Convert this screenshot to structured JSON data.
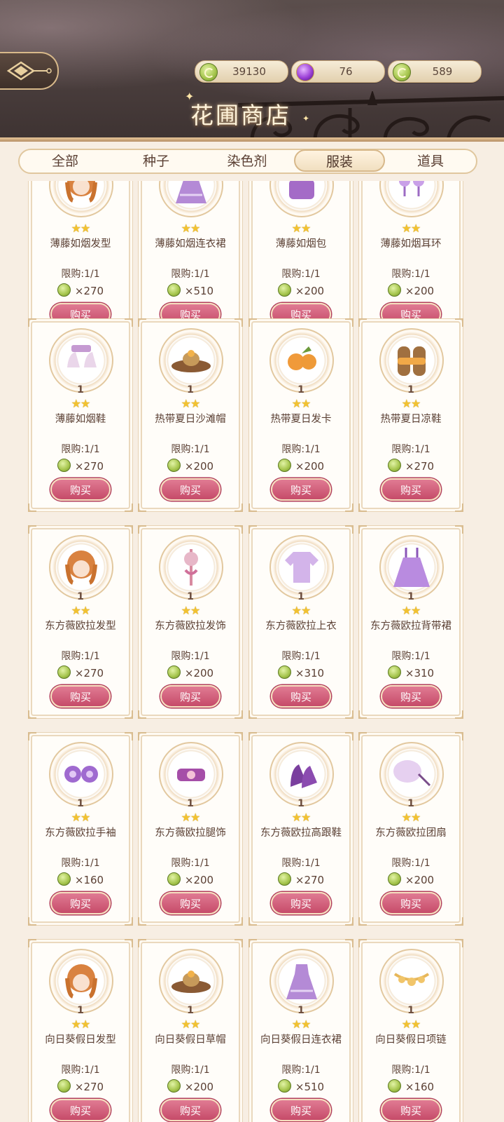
{
  "header": {
    "title": "花圃商店",
    "currencies": [
      {
        "icon": "green-coin-icon",
        "value": "39130"
      },
      {
        "icon": "purple-gem-icon",
        "value": "76"
      },
      {
        "icon": "green-coin-icon",
        "value": "589"
      }
    ]
  },
  "tabs": [
    {
      "label": "全部",
      "active": false
    },
    {
      "label": "种子",
      "active": false
    },
    {
      "label": "染色剂",
      "active": false
    },
    {
      "label": "服装",
      "active": true
    },
    {
      "label": "道具",
      "active": false
    }
  ],
  "buy_label": "购买",
  "colors": {
    "accent": "#c64b69",
    "star": "#f2c230",
    "background": "#f7eee3"
  },
  "rows": [
    [
      {
        "name": "薄藤如烟发型",
        "qty": "",
        "stars": "★★",
        "limit": "限购:1/1",
        "price": "×270",
        "icon": "hairstyle-icon"
      },
      {
        "name": "薄藤如烟连衣裙",
        "qty": "",
        "stars": "★★",
        "limit": "限购:1/1",
        "price": "×510",
        "icon": "dress-icon"
      },
      {
        "name": "薄藤如烟包",
        "qty": "",
        "stars": "★★",
        "limit": "限购:1/1",
        "price": "×200",
        "icon": "bag-icon"
      },
      {
        "name": "薄藤如烟耳环",
        "qty": "",
        "stars": "★★",
        "limit": "限购:1/1",
        "price": "×200",
        "icon": "earring-icon"
      }
    ],
    [
      {
        "name": "薄藤如烟鞋",
        "qty": "1",
        "stars": "★★",
        "limit": "限购:1/1",
        "price": "×270",
        "icon": "shoes-icon"
      },
      {
        "name": "热带夏日沙滩帽",
        "qty": "1",
        "stars": "★★",
        "limit": "限购:1/1",
        "price": "×200",
        "icon": "straw-hat-icon"
      },
      {
        "name": "热带夏日发卡",
        "qty": "1",
        "stars": "★★",
        "limit": "限购:1/1",
        "price": "×200",
        "icon": "hairclip-icon"
      },
      {
        "name": "热带夏日凉鞋",
        "qty": "1",
        "stars": "★★",
        "limit": "限购:1/1",
        "price": "×270",
        "icon": "sandals-icon"
      }
    ],
    [
      {
        "name": "东方薇欧拉发型",
        "qty": "1",
        "stars": "★★",
        "limit": "限购:1/1",
        "price": "×270",
        "icon": "hairstyle-icon"
      },
      {
        "name": "东方薇欧拉发饰",
        "qty": "1",
        "stars": "★★",
        "limit": "限购:1/1",
        "price": "×200",
        "icon": "hair-ornament-icon"
      },
      {
        "name": "东方薇欧拉上衣",
        "qty": "1",
        "stars": "★★",
        "limit": "限购:1/1",
        "price": "×310",
        "icon": "top-icon"
      },
      {
        "name": "东方薇欧拉背带裙",
        "qty": "1",
        "stars": "★★",
        "limit": "限购:1/1",
        "price": "×310",
        "icon": "pinafore-dress-icon"
      }
    ],
    [
      {
        "name": "东方薇欧拉手袖",
        "qty": "1",
        "stars": "★★",
        "limit": "限购:1/1",
        "price": "×160",
        "icon": "sleeves-icon"
      },
      {
        "name": "东方薇欧拉腿饰",
        "qty": "1",
        "stars": "★★",
        "limit": "限购:1/1",
        "price": "×200",
        "icon": "leg-ornament-icon"
      },
      {
        "name": "东方薇欧拉高跟鞋",
        "qty": "1",
        "stars": "★★",
        "limit": "限购:1/1",
        "price": "×270",
        "icon": "heels-icon"
      },
      {
        "name": "东方薇欧拉团扇",
        "qty": "1",
        "stars": "★★",
        "limit": "限购:1/1",
        "price": "×200",
        "icon": "fan-icon"
      }
    ],
    [
      {
        "name": "向日葵假日发型",
        "qty": "1",
        "stars": "★★",
        "limit": "限购:1/1",
        "price": "×270",
        "icon": "hairstyle-icon"
      },
      {
        "name": "向日葵假日草帽",
        "qty": "1",
        "stars": "★★",
        "limit": "限购:1/1",
        "price": "×200",
        "icon": "straw-hat-icon"
      },
      {
        "name": "向日葵假日连衣裙",
        "qty": "1",
        "stars": "★★",
        "limit": "限购:1/1",
        "price": "×510",
        "icon": "dress-icon"
      },
      {
        "name": "向日葵假日项链",
        "qty": "1",
        "stars": "★★",
        "limit": "限购:1/1",
        "price": "×160",
        "icon": "necklace-icon"
      }
    ]
  ]
}
